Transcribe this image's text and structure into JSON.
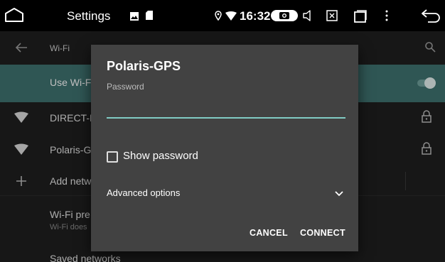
{
  "statusbar": {
    "title": "Settings",
    "time": "16:32"
  },
  "header": {
    "title": "Wi-Fi"
  },
  "list": {
    "use_wifi_label": "Use Wi-F",
    "networks": [
      {
        "name": "DIRECT-N"
      },
      {
        "name": "Polaris-G"
      }
    ],
    "add_network_label": "Add netw",
    "preferences": {
      "title": "Wi-Fi pre",
      "subtitle": "Wi-Fi does"
    },
    "saved_label": "Saved networks"
  },
  "dialog": {
    "title": "Polaris-GPS",
    "password_label": "Password",
    "password_value": "",
    "show_password_label": "Show password",
    "show_password_checked": false,
    "advanced_label": "Advanced options",
    "cancel_label": "CANCEL",
    "connect_label": "CONNECT"
  },
  "colors": {
    "use_wifi_row": "#3f7371",
    "accent_underline": "#80cbc4",
    "dialog_bg": "#424242",
    "screen_bg": "#1f1f1f"
  }
}
